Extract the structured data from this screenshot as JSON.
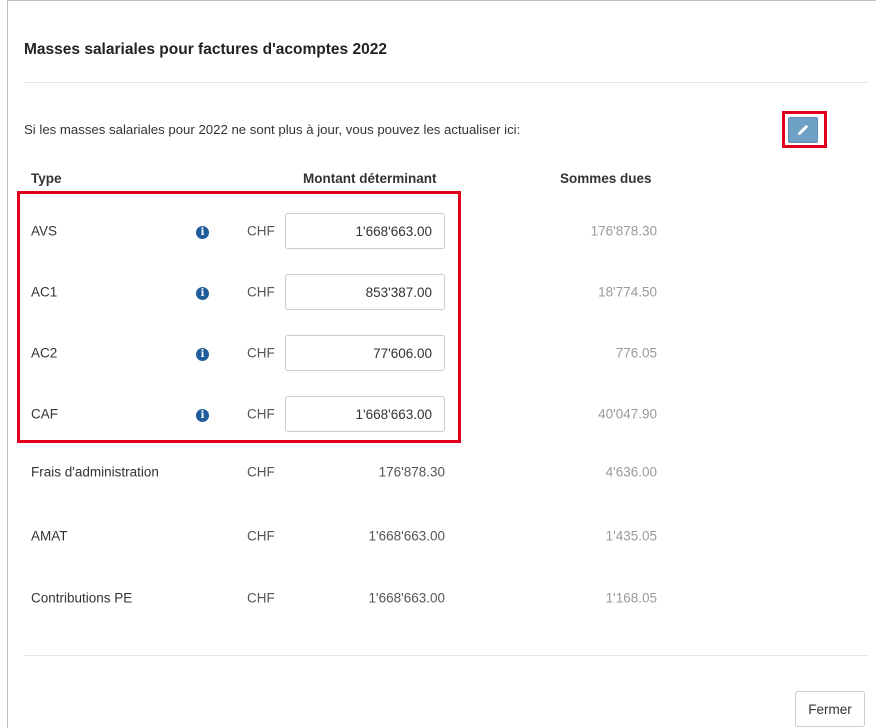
{
  "dialog": {
    "title": "Masses salariales pour factures d'acomptes 2022",
    "close_glyph": "×",
    "intro": "Si les masses salariales pour 2022 ne sont plus à jour, vous pouvez les actualiser ici:",
    "edit_icon": "pencil-icon",
    "accent_color": "#6fa0c6",
    "highlight_color": "#e0001b"
  },
  "table": {
    "headers": {
      "type": "Type",
      "montant": "Montant déterminant",
      "sommes": "Sommes dues"
    },
    "editable_rows": [
      {
        "type": "AVS",
        "info_icon": "info-icon",
        "currency": "CHF",
        "amount": "1'668'663.00",
        "due": "176'878.30"
      },
      {
        "type": "AC1",
        "info_icon": "info-icon",
        "currency": "CHF",
        "amount": "853'387.00",
        "due": "18'774.50"
      },
      {
        "type": "AC2",
        "info_icon": "info-icon",
        "currency": "CHF",
        "amount": "77'606.00",
        "due": "776.05"
      },
      {
        "type": "CAF",
        "info_icon": "info-icon",
        "currency": "CHF",
        "amount": "1'668'663.00",
        "due": "40'047.90"
      }
    ],
    "static_rows": [
      {
        "type": "Frais d'administration",
        "currency": "CHF",
        "amount": "176'878.30",
        "due": "4'636.00"
      },
      {
        "type": "AMAT",
        "currency": "CHF",
        "amount": "1'668'663.00",
        "due": "1'435.05"
      },
      {
        "type": "Contributions PE",
        "currency": "CHF",
        "amount": "1'668'663.00",
        "due": "1'168.05"
      }
    ]
  },
  "footer": {
    "close_label": "Fermer"
  }
}
